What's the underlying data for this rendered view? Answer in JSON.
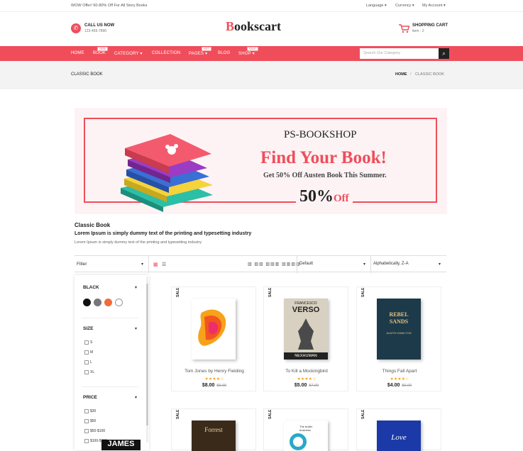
{
  "topbar": {
    "offer": "WOW Offer! 60-80% Off For All Story Books",
    "language": "Language",
    "currency": "Currency",
    "account": "My Account"
  },
  "header": {
    "call_label": "CALL US NOW",
    "phone": "123-456-7890",
    "logo": "ookscart",
    "logo_initial": "B",
    "cart_label": "SHOPPING CART",
    "cart_items": "item - 2"
  },
  "nav": {
    "items": [
      {
        "label": "HOME",
        "badge": ""
      },
      {
        "label": "BOOK",
        "badge": "NEW"
      },
      {
        "label": "CATEGORY",
        "badge": ""
      },
      {
        "label": "COLLECTION",
        "badge": ""
      },
      {
        "label": "PAGES",
        "badge": "HOT"
      },
      {
        "label": "BLOG",
        "badge": ""
      },
      {
        "label": "SHOP",
        "badge": "SALE"
      }
    ],
    "search_placeholder": "Search Our Category"
  },
  "breadcrumb": {
    "page_title": "CLASSIC BOOK",
    "home": "HOME",
    "separator": "/",
    "current": "CLASSIC BOOK"
  },
  "banner": {
    "brand": "PS-BOOKSHOP",
    "headline": "Find Your Book!",
    "subline": "Get 50% Off Austen Book This Summer.",
    "percent": "50%",
    "off": "Off"
  },
  "category": {
    "title": "Classic Book",
    "subtitle": "Lorem Ipsum is simply dummy text of the printing and typesetting industry",
    "description": "Lorem Ipsum is simply dummy text of the printing and typesetting industry"
  },
  "toolbar": {
    "filter_label": "Filter",
    "per_page": "Default",
    "sort": "Alphabetically, Z-A"
  },
  "sidebar": {
    "color_title": "BLACK",
    "colors": [
      "#111111",
      "#777777",
      "#f26b3a",
      "#ffffff"
    ],
    "size_title": "SIZE",
    "sizes": [
      "S",
      "M",
      "L",
      "XL"
    ],
    "price_title": "PRICE",
    "prices": [
      "$30",
      "$50",
      "$50-$100",
      "$100-$150"
    ]
  },
  "products": [
    {
      "name": "Tom Jones by Henry Fielding",
      "price": "$8.00",
      "old_price": "$9.00",
      "sale": "SALE",
      "stars": "★★★★☆",
      "rating": 4
    },
    {
      "name": "To Kill a Mockingbird",
      "price": "$5.00",
      "old_price": "$7.00",
      "sale": "SALE",
      "stars": "★★★★☆",
      "rating": 4
    },
    {
      "name": "Things Fall Apart",
      "price": "$4.00",
      "old_price": "$6.00",
      "sale": "SALE",
      "stars": "★★★★☆",
      "rating": 4
    },
    {
      "sale": "SALE",
      "cover_title": "Forrest"
    },
    {
      "sale": "SALE",
      "cover_title": "The butter business"
    },
    {
      "sale": "SALE",
      "cover_title": "Love"
    }
  ],
  "covers": {
    "verso_author": "FRANCESCO",
    "verso_title": "VERSO",
    "verso_bottom": "NEXHUMAN",
    "rebel_title": "REBEL SANDS",
    "rebel_author": "ALWYN HAMILTON",
    "peek_left": "JAMES"
  }
}
